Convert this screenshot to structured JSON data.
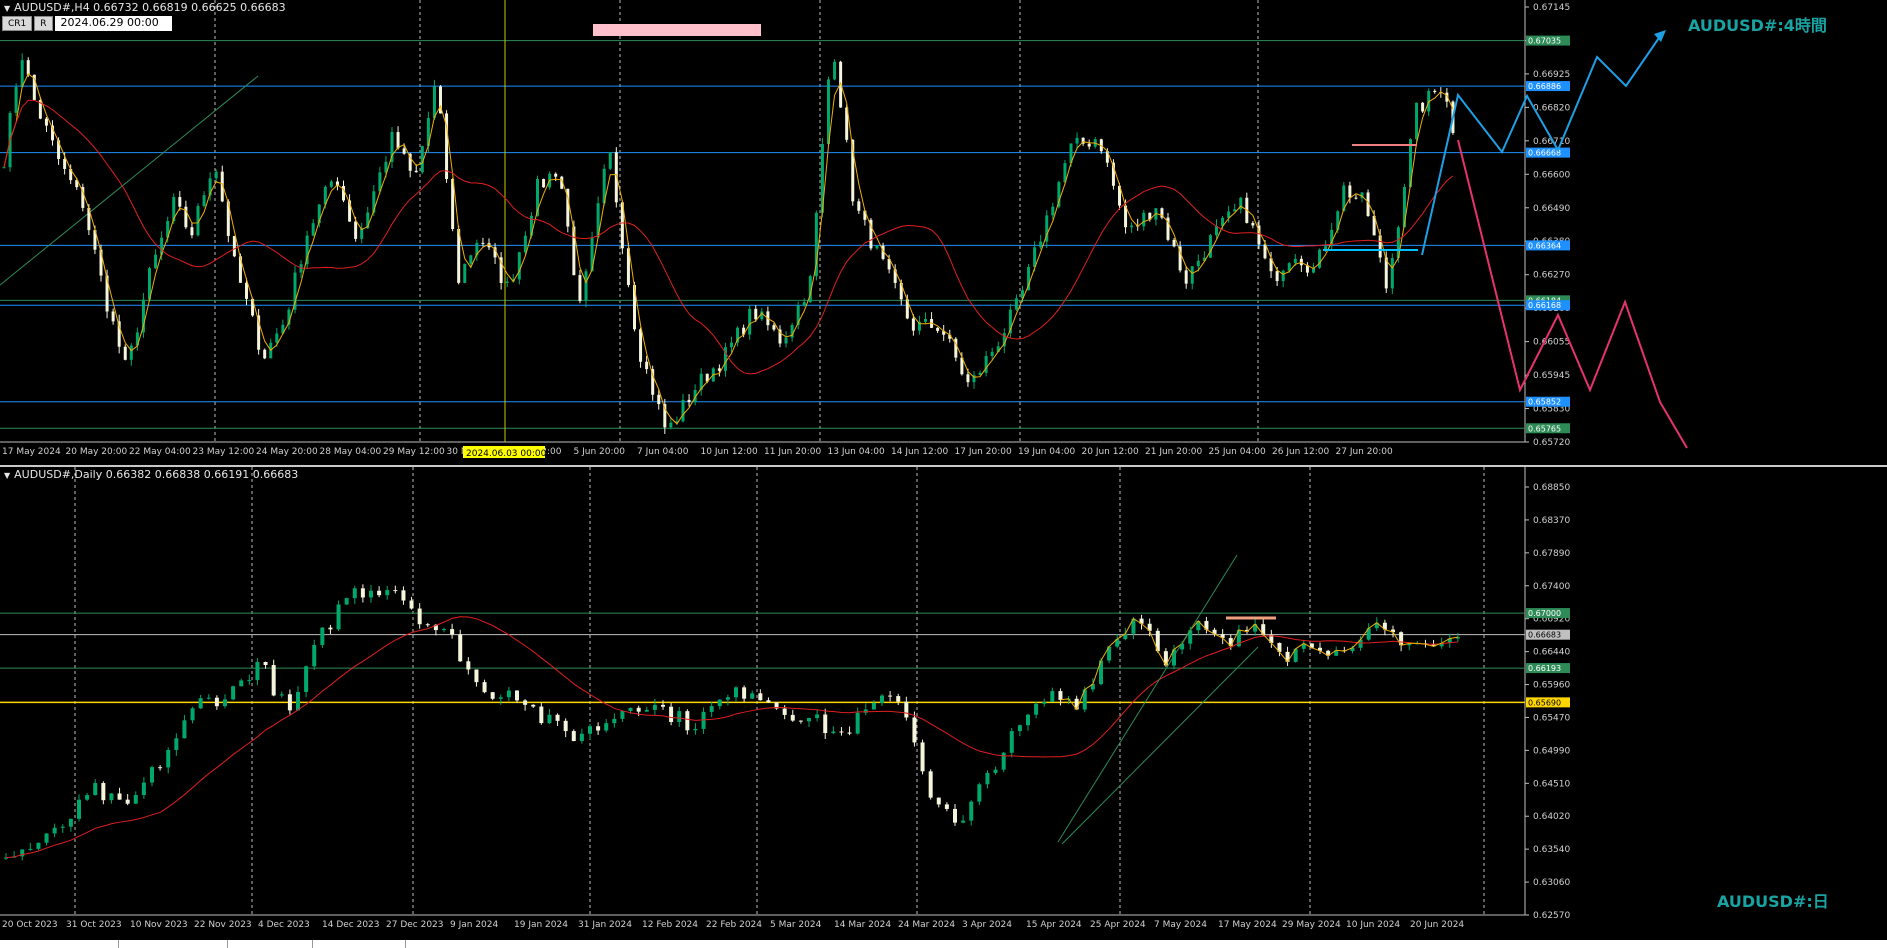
{
  "h4": {
    "header": "AUDUSD#,H4  0.66732 0.66819 0.66625 0.66683",
    "buttons": [
      "CR1",
      "R"
    ],
    "date_input": "2024.06.29 00:00",
    "title": "AUDUSD#:4時間",
    "vline_label": "2024.06.03 00:00",
    "price_ticks": [
      "0.67145",
      "0.67035",
      "0.66925",
      "0.66820",
      "0.66710",
      "0.66600",
      "0.66490",
      "0.66380",
      "0.66270",
      "0.66160",
      "0.66055",
      "0.65945",
      "0.65830",
      "0.65720"
    ],
    "level_labels": [
      {
        "text": "0.67035",
        "color": "#2e8b57",
        "price": 0.67035
      },
      {
        "text": "0.66886",
        "color": "#1e90ff",
        "price": 0.66886
      },
      {
        "text": "0.66668",
        "color": "#1e90ff",
        "price": 0.66668
      },
      {
        "text": "0.66364",
        "color": "#1e90ff",
        "price": 0.66364
      },
      {
        "text": "0.66184",
        "color": "#2e8b57",
        "price": 0.66184
      },
      {
        "text": "0.66168",
        "color": "#1e90ff",
        "price": 0.66168
      },
      {
        "text": "0.65852",
        "color": "#1e90ff",
        "price": 0.65852
      },
      {
        "text": "0.65765",
        "color": "#2e8b57",
        "price": 0.65765
      }
    ],
    "time_labels": [
      "17 May 2024",
      "20 May 20:00",
      "22 May 04:00",
      "23 May 12:00",
      "24 May 20:00",
      "28 May 04:00",
      "29 May 12:00",
      "30 May",
      "4 Jun 12:00",
      "5 Jun 20:00",
      "7 Jun 04:00",
      "10 Jun 12:00",
      "11 Jun 20:00",
      "13 Jun 04:00",
      "14 Jun 12:00",
      "17 Jun 20:00",
      "19 Jun 04:00",
      "20 Jun 12:00",
      "21 Jun 20:00",
      "25 Jun 04:00",
      "26 Jun 12:00",
      "27 Jun 20:00"
    ]
  },
  "d1": {
    "header": "AUDUSD#,Daily  0.66382 0.66838 0.66191 0.66683",
    "title": "AUDUSD#:日",
    "price_ticks": [
      "0.68850",
      "0.68370",
      "0.67890",
      "0.67400",
      "0.66920",
      "0.66440",
      "0.65960",
      "0.65470",
      "0.64990",
      "0.64510",
      "0.64020",
      "0.63540",
      "0.63060",
      "0.62570"
    ],
    "level_labels": [
      {
        "text": "0.67000",
        "color": "#2e8b57",
        "price": 0.67
      },
      {
        "text": "0.66683",
        "color": "#c0c0c0",
        "price": 0.66683
      },
      {
        "text": "0.66193",
        "color": "#2e8b57",
        "price": 0.66193
      },
      {
        "text": "0.65690",
        "color": "#ffd700",
        "price": 0.6569
      }
    ],
    "time_labels": [
      "20 Oct 2023",
      "31 Oct 2023",
      "10 Nov 2023",
      "22 Nov 2023",
      "4 Dec 2023",
      "14 Dec 2023",
      "27 Dec 2023",
      "9 Jan 2024",
      "19 Jan 2024",
      "31 Jan 2024",
      "12 Feb 2024",
      "22 Feb 2024",
      "5 Mar 2024",
      "14 Mar 2024",
      "24 Mar 2024",
      "3 Apr 2024",
      "15 Apr 2024",
      "25 Apr 2024",
      "7 May 2024",
      "17 May 2024",
      "29 May 2024",
      "10 Jun 2024",
      "20 Jun 2024"
    ]
  },
  "colors": {
    "bull": "#00a86b",
    "bear": "#f5f5dc",
    "ma": "#e01f1f",
    "smooth": "#f0b000",
    "grid": "#ffffff",
    "level_blue": "#1e90ff",
    "level_green": "#2e8b57",
    "forecast_up": "#1ea0e6",
    "forecast_down": "#e6336e",
    "title": "#1aa3a3"
  }
}
